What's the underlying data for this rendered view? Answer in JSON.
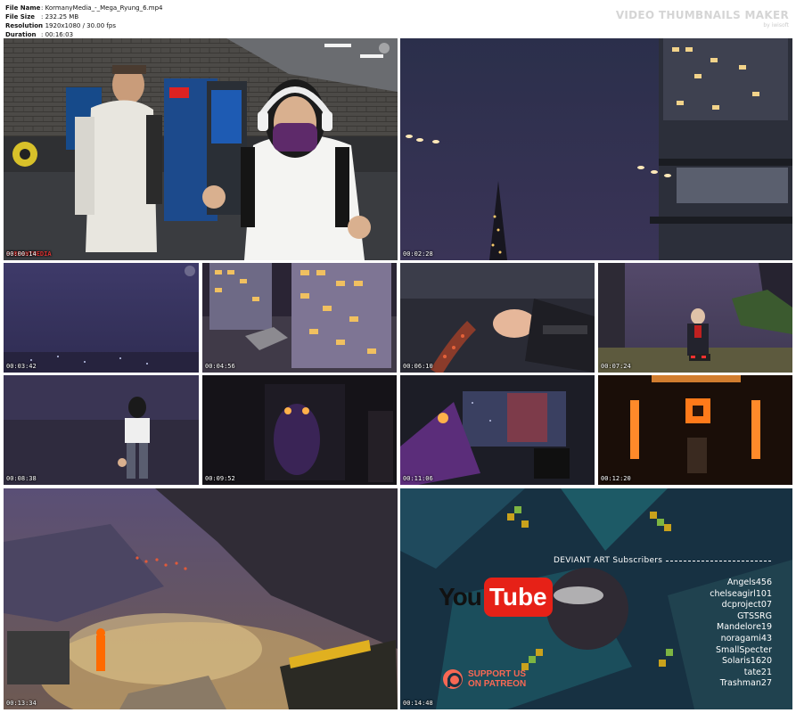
{
  "header": {
    "rows": [
      {
        "label": "File Name",
        "value": ": KormanyMedia_-_Mega_Ryung_6.mp4"
      },
      {
        "label": "File Size",
        "value": ": 232.25 MB"
      },
      {
        "label": "Resolution",
        "value": ": 1920x1080 / 30.00 fps"
      },
      {
        "label": "Duration",
        "value": ": 00:16:03"
      }
    ],
    "brand": "VIDEO THUMBNAILS MAKER",
    "brand_sub": "by iwisoft"
  },
  "thumbs": [
    {
      "time": "00:00:14",
      "overlay": "KORMANYMEDIA"
    },
    {
      "time": "00:02:28"
    },
    {
      "time": "00:03:42"
    },
    {
      "time": "00:04:56"
    },
    {
      "time": "00:06:10"
    },
    {
      "time": "00:07:24"
    },
    {
      "time": "00:08:38"
    },
    {
      "time": "00:09:52"
    },
    {
      "time": "00:11:06"
    },
    {
      "time": "00:12:20"
    },
    {
      "time": "00:13:34"
    },
    {
      "time": "00:14:48"
    }
  ],
  "credits": {
    "heading": "DEVIANT ART Subscribers",
    "names": [
      "Angels456",
      "chelseagirl101",
      "dcproject07",
      "GTSSRG",
      "Mandelore19",
      "noragami43",
      "SmallSpecter",
      "Solaris1620",
      "tate21",
      "Trashman27"
    ],
    "youtube_you": "You",
    "youtube_tube": "Tube",
    "patreon_line1": "SUPPORT US",
    "patreon_line2": "ON PATREON"
  },
  "colors": {
    "youtube_red": "#e62117",
    "patreon_orange": "#f96854"
  }
}
